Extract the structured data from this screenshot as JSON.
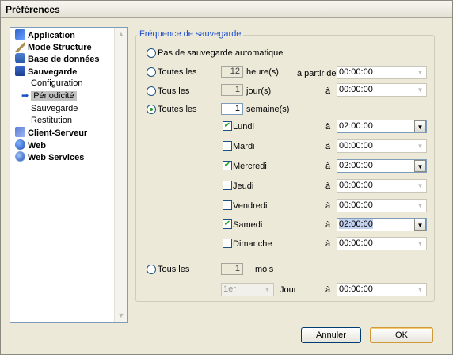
{
  "window": {
    "title": "Préférences"
  },
  "sidebar": {
    "items": [
      {
        "label": "Application",
        "icon": "application-icon"
      },
      {
        "label": "Mode Structure",
        "icon": "structure-icon"
      },
      {
        "label": "Base de données",
        "icon": "database-icon"
      },
      {
        "label": "Sauvegarde",
        "icon": "backup-icon"
      },
      {
        "label": "Configuration"
      },
      {
        "label": "Périodicité",
        "selected": true
      },
      {
        "label": "Sauvegarde"
      },
      {
        "label": "Restitution"
      },
      {
        "label": "Client-Serveur",
        "icon": "client-server-icon"
      },
      {
        "label": "Web",
        "icon": "web-icon"
      },
      {
        "label": "Web Services",
        "icon": "web-services-icon"
      }
    ]
  },
  "frequency": {
    "group_title": "Fréquence de sauvegarde",
    "no_backup_label": "Pas de sauvegarde automatique",
    "hours": {
      "label": "Toutes les",
      "value": "12",
      "unit": "heure(s)",
      "from_label": "à partir de",
      "time": "00:00:00"
    },
    "days": {
      "label": "Tous les",
      "value": "1",
      "unit": "jour(s)",
      "at_label": "à",
      "time": "00:00:00"
    },
    "weeks": {
      "label": "Toutes les",
      "value": "1",
      "unit": "semaine(s)",
      "selected": true
    },
    "weekdays": [
      {
        "label": "Lundi",
        "checked": true,
        "at": "à",
        "time": "02:00:00"
      },
      {
        "label": "Mardi",
        "checked": false,
        "at": "à",
        "time": "00:00:00"
      },
      {
        "label": "Mercredi",
        "checked": true,
        "at": "à",
        "time": "02:00:00"
      },
      {
        "label": "Jeudi",
        "checked": false,
        "at": "à",
        "time": "00:00:00"
      },
      {
        "label": "Vendredi",
        "checked": false,
        "at": "à",
        "time": "00:00:00"
      },
      {
        "label": "Samedi",
        "checked": true,
        "at": "à",
        "time": "02:00:00"
      },
      {
        "label": "Dimanche",
        "checked": false,
        "at": "à",
        "time": "00:00:00"
      }
    ],
    "months": {
      "label": "Tous les",
      "value": "1",
      "unit": "mois",
      "day_select": "1er",
      "day_label": "Jour",
      "at_label": "à",
      "time": "00:00:00"
    }
  },
  "buttons": {
    "cancel": "Annuler",
    "ok": "OK"
  }
}
